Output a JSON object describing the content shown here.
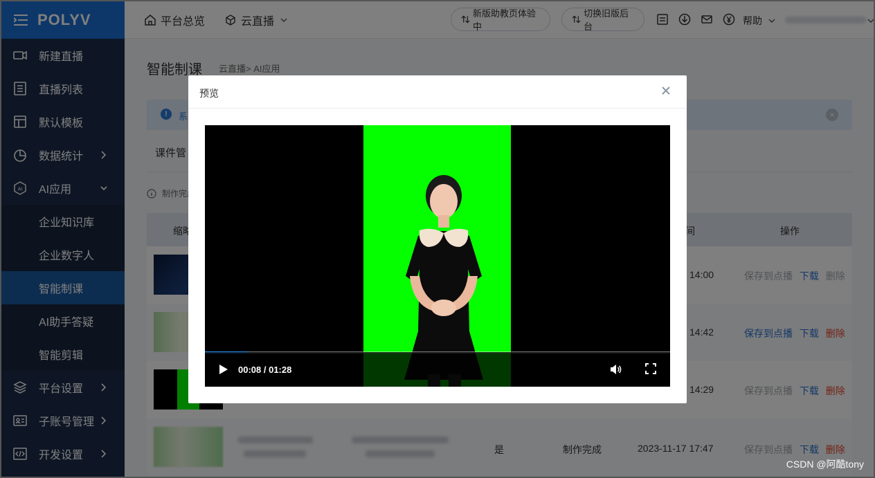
{
  "app": {
    "logo": "POLYV"
  },
  "sidebar": {
    "items": [
      {
        "label": "新建直播"
      },
      {
        "label": "直播列表"
      },
      {
        "label": "默认模板"
      },
      {
        "label": "数据统计"
      },
      {
        "label": "AI应用"
      },
      {
        "label": "企业知识库"
      },
      {
        "label": "企业数字人"
      },
      {
        "label": "智能制课"
      },
      {
        "label": "AI助手答疑"
      },
      {
        "label": "智能剪辑"
      },
      {
        "label": "平台设置"
      },
      {
        "label": "子账号管理"
      },
      {
        "label": "开发设置"
      }
    ]
  },
  "header": {
    "nav_overview": "平台总览",
    "nav_cloud": "云直播",
    "pill_new": "新版助教页体验中",
    "pill_switch": "切换旧版后台",
    "help": "帮助"
  },
  "page": {
    "title": "智能制课",
    "breadcrumb": "云直播> AI应用",
    "notice": "系",
    "tab": "课件管",
    "hint": "制作完成",
    "table_headers": {
      "thumb": "缩略",
      "time": "间",
      "action": "操作"
    },
    "rows": [
      {
        "time": "14:00",
        "save": "保存到点播",
        "download": "下载",
        "delete": "删除"
      },
      {
        "time": "14:42",
        "save": "保存到点播",
        "download": "下载",
        "delete": "删除"
      },
      {
        "time": "14:29",
        "save": "保存到点播",
        "download": "下载",
        "delete": "删除"
      },
      {
        "yes": "是",
        "status": "制作完成",
        "time": "2023-11-17 17:47",
        "save": "保存到点播",
        "download": "下载",
        "delete": "删除"
      }
    ]
  },
  "modal": {
    "title": "预览",
    "video": {
      "current": "00:08",
      "duration": "01:28",
      "time_text": "00:08 / 01:28",
      "progress": 0.091
    }
  },
  "watermark": "CSDN @阿酷tony",
  "colors": {
    "primary": "#1a6fd0",
    "sidebar": "#1c2d4a",
    "active": "#1b5aa1",
    "green_screen": "#06ff00",
    "danger": "#e2472f"
  }
}
